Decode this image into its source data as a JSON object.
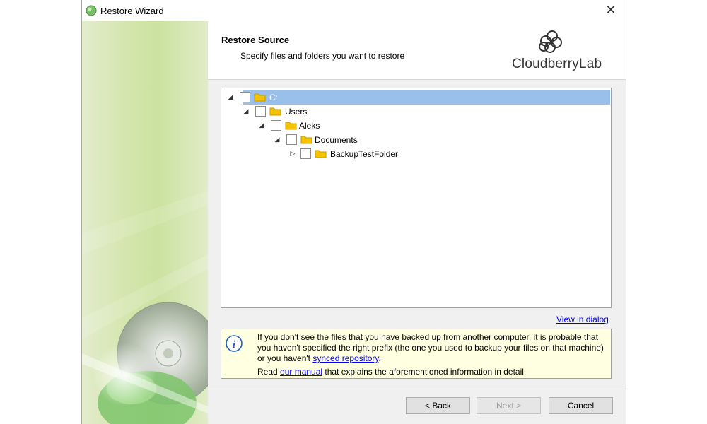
{
  "window": {
    "title": "Restore Wizard",
    "close_label": "✕"
  },
  "header": {
    "title": "Restore Source",
    "subtitle": "Specify files and folders you want to restore",
    "logo_text": "CloudberryLab"
  },
  "tree": {
    "nodes": [
      {
        "label": "C:",
        "expanded": true,
        "selected": true,
        "checked": false
      },
      {
        "label": "Users",
        "expanded": true,
        "selected": false,
        "checked": false
      },
      {
        "label": "Aleks",
        "expanded": true,
        "selected": false,
        "checked": false
      },
      {
        "label": "Documents",
        "expanded": true,
        "selected": false,
        "checked": false
      },
      {
        "label": "BackupTestFolder",
        "expanded": false,
        "selected": false,
        "checked": false
      }
    ]
  },
  "view_in_dialog": "View in dialog",
  "info": {
    "text_before_link": "If you don't see the files that you have backed up from another computer, it is probable that you haven't specified the right prefix (the one you used to backup your files on that machine) or you haven't ",
    "synced_link": "synced repository",
    "text_after_link": ".",
    "read_prefix": "Read ",
    "manual_link": "our manual",
    "read_suffix": " that explains the aforementioned information in detail."
  },
  "buttons": {
    "back": "< Back",
    "next": "Next >",
    "cancel": "Cancel"
  },
  "colors": {
    "selection": "#99c0eb",
    "info_bg": "#ffffe1",
    "link": "#0000ee",
    "folder": "#f5c400"
  }
}
